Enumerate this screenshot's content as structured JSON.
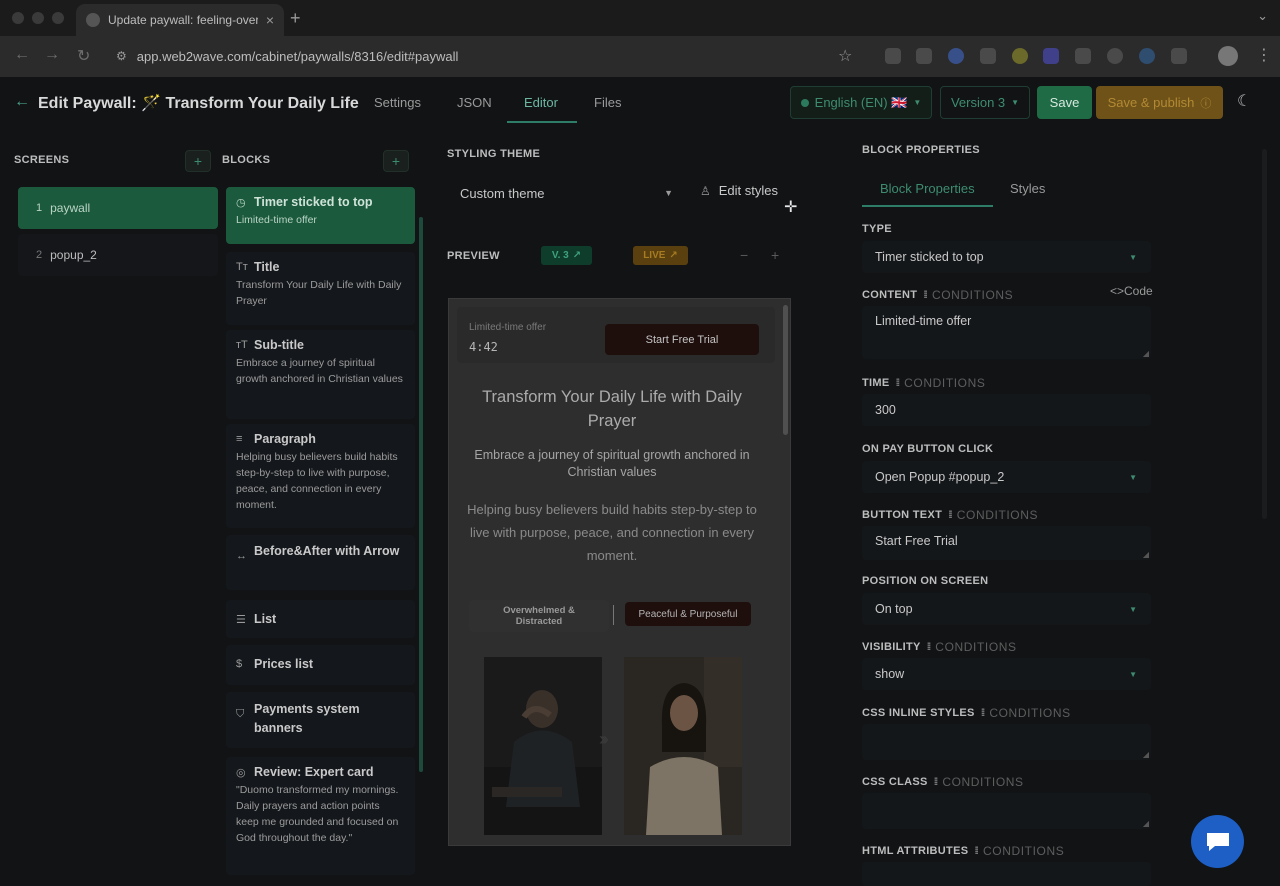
{
  "browser": {
    "tab_title": "Update paywall: feeling-over",
    "url": "app.web2wave.com/cabinet/paywalls/8316/edit#paywall"
  },
  "header": {
    "title": "Edit Paywall: 🪄 Transform Your Daily Life",
    "tabs": [
      {
        "label": "Settings"
      },
      {
        "label": "JSON"
      },
      {
        "label": "Editor"
      },
      {
        "label": "Files"
      }
    ],
    "active_tab": "Editor",
    "language": "English (EN) 🇬🇧",
    "version": "Version 3",
    "save_label": "Save",
    "publish_label": "Save & publish"
  },
  "screens": {
    "label": "SCREENS",
    "add": "+",
    "items": [
      {
        "num": "1",
        "name": "paywall"
      },
      {
        "num": "2",
        "name": "popup_2"
      }
    ]
  },
  "blocks": {
    "label": "BLOCKS",
    "add": "+",
    "items": [
      {
        "icon": "◷",
        "title": "Timer sticked to top",
        "desc": "Limited-time offer"
      },
      {
        "icon": "Tт",
        "title": "Title",
        "desc": "Transform Your Daily Life with Daily Prayer"
      },
      {
        "icon": "тT",
        "title": "Sub-title",
        "desc": "Embrace a journey of spiritual growth anchored in Christian values"
      },
      {
        "icon": "≡",
        "title": "Paragraph",
        "desc": "Helping busy believers build habits step-by-step to live with purpose, peace, and connection in every moment."
      },
      {
        "icon": "↔",
        "title": "Before&After with Arrow",
        "desc": ""
      },
      {
        "icon": "☰",
        "title": "List",
        "desc": ""
      },
      {
        "icon": "$",
        "title": "Prices list",
        "desc": ""
      },
      {
        "icon": "⛉",
        "title": "Payments system banners",
        "desc": ""
      },
      {
        "icon": "◎",
        "title": "Review: Expert card",
        "desc": "\"Duomo transformed my mornings. Daily prayers and action points keep me grounded and focused on God throughout the day.\""
      }
    ]
  },
  "styling": {
    "label": "STYLING THEME",
    "theme": "Custom theme",
    "edit_styles": "Edit styles"
  },
  "preview": {
    "label": "PREVIEW",
    "version_badge": "V. 3",
    "live_badge": "LIVE",
    "zoom_out": "−",
    "zoom_in": "+",
    "timer_label": "Limited-time offer",
    "timer_value": "4:42",
    "cta": "Start Free Trial",
    "title": "Transform Your Daily Life with Daily Prayer",
    "subtitle": "Embrace a journey of spiritual growth anchored in Christian values",
    "paragraph": "Helping busy believers build habits step-by-step to live with purpose, peace, and connection in every moment.",
    "toggle_before": "Overwhelmed & Distracted",
    "toggle_after": "Peaceful & Purposeful"
  },
  "properties": {
    "label": "BLOCK PROPERTIES",
    "tabs": [
      {
        "label": "Block Properties"
      },
      {
        "label": "Styles"
      }
    ],
    "conditions_word": "CONDITIONS",
    "code_link": "<>Code",
    "fields": {
      "type": {
        "label": "TYPE",
        "value": "Timer sticked to top"
      },
      "content": {
        "label": "CONTENT",
        "value": "Limited-time offer"
      },
      "time": {
        "label": "TIME",
        "value": "300"
      },
      "on_pay": {
        "label": "ON PAY BUTTON CLICK",
        "value": "Open Popup #popup_2"
      },
      "button_text": {
        "label": "BUTTON TEXT",
        "value": "Start Free Trial"
      },
      "position": {
        "label": "POSITION ON SCREEN",
        "value": "On top"
      },
      "visibility": {
        "label": "VISIBILITY",
        "value": "show"
      },
      "css_inline": {
        "label": "CSS INLINE STYLES",
        "value": ""
      },
      "css_class": {
        "label": "CSS CLASS",
        "value": ""
      },
      "html_attrs": {
        "label": "HTML ATTRIBUTES",
        "value": ""
      }
    }
  },
  "colors": {
    "accent": "#2e7d67",
    "save": "#1e6b46",
    "publish": "#6e5218",
    "chat": "#1d5fc5"
  }
}
